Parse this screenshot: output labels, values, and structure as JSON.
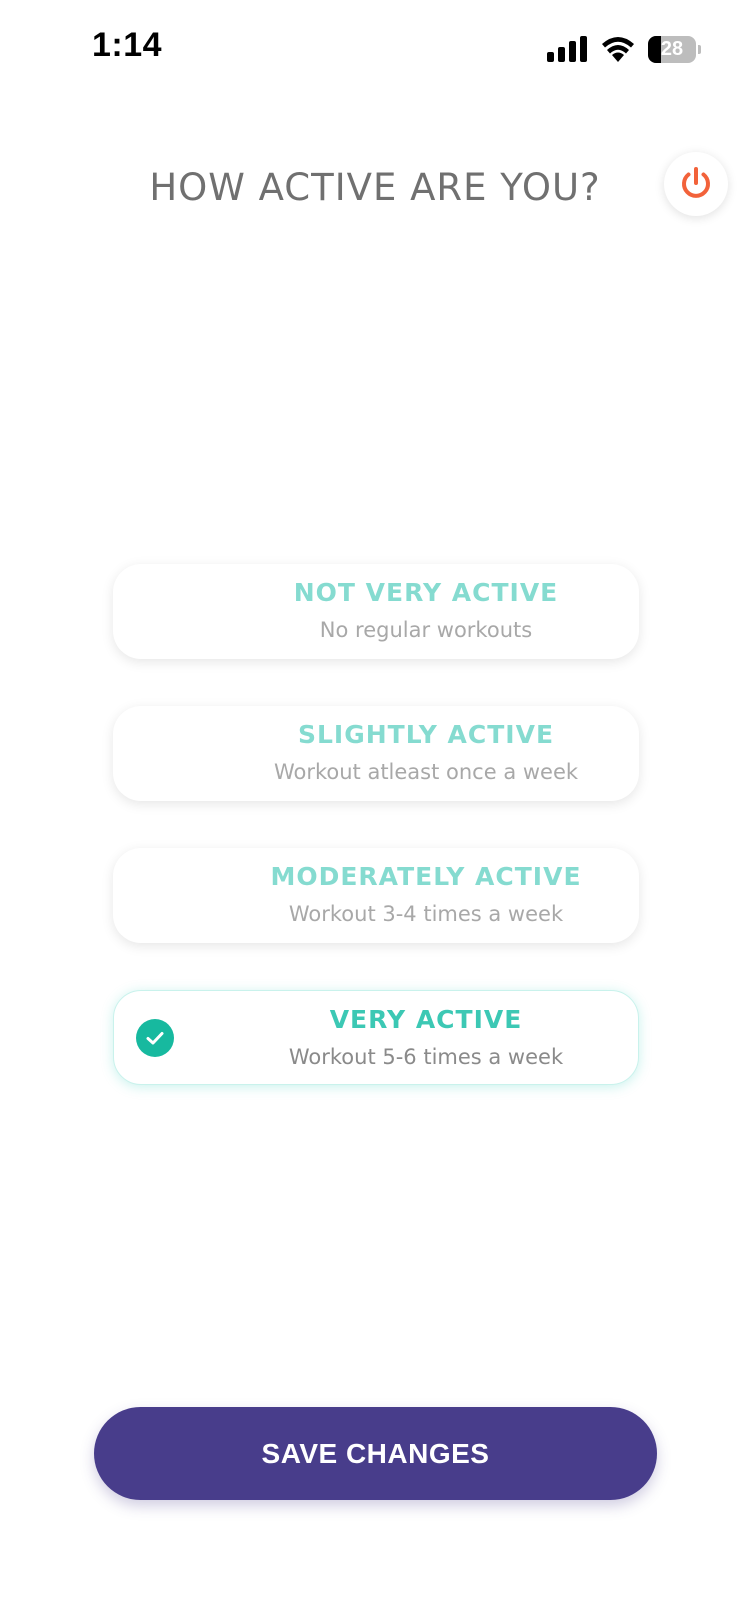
{
  "status_bar": {
    "time": "1:14",
    "battery_level": "28",
    "battery_fraction": 0.28,
    "signal_icon": "cellular-signal-icon",
    "wifi_icon": "wifi-icon"
  },
  "header": {
    "title": "HOW ACTIVE ARE YOU?",
    "power_icon": "power-icon"
  },
  "options": [
    {
      "title": "NOT VERY ACTIVE",
      "subtitle": "No regular workouts",
      "selected": false
    },
    {
      "title": "SLIGHTLY ACTIVE",
      "subtitle": "Workout atleast once a week",
      "selected": false
    },
    {
      "title": "MODERATELY ACTIVE",
      "subtitle": "Workout 3-4 times a week",
      "selected": false
    },
    {
      "title": "VERY ACTIVE",
      "subtitle": "Workout 5-6 times a week",
      "selected": true
    }
  ],
  "save_button": {
    "label": "SAVE CHANGES"
  },
  "colors": {
    "accent_teal": "#3cc8b4",
    "check_green": "#17b99f",
    "power_orange": "#f2623a",
    "button_purple": "#483d8b",
    "title_gray": "#707070"
  }
}
